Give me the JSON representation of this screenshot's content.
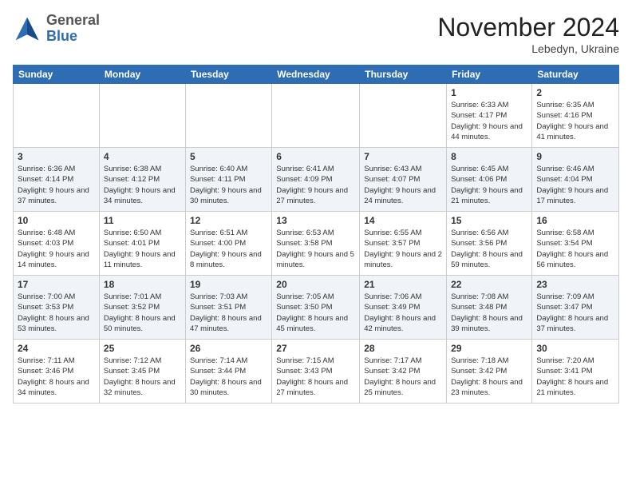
{
  "logo": {
    "general": "General",
    "blue": "Blue"
  },
  "header": {
    "month": "November 2024",
    "location": "Lebedyn, Ukraine"
  },
  "days_of_week": [
    "Sunday",
    "Monday",
    "Tuesday",
    "Wednesday",
    "Thursday",
    "Friday",
    "Saturday"
  ],
  "weeks": [
    [
      {
        "day": "",
        "info": ""
      },
      {
        "day": "",
        "info": ""
      },
      {
        "day": "",
        "info": ""
      },
      {
        "day": "",
        "info": ""
      },
      {
        "day": "",
        "info": ""
      },
      {
        "day": "1",
        "info": "Sunrise: 6:33 AM\nSunset: 4:17 PM\nDaylight: 9 hours\nand 44 minutes."
      },
      {
        "day": "2",
        "info": "Sunrise: 6:35 AM\nSunset: 4:16 PM\nDaylight: 9 hours\nand 41 minutes."
      }
    ],
    [
      {
        "day": "3",
        "info": "Sunrise: 6:36 AM\nSunset: 4:14 PM\nDaylight: 9 hours\nand 37 minutes."
      },
      {
        "day": "4",
        "info": "Sunrise: 6:38 AM\nSunset: 4:12 PM\nDaylight: 9 hours\nand 34 minutes."
      },
      {
        "day": "5",
        "info": "Sunrise: 6:40 AM\nSunset: 4:11 PM\nDaylight: 9 hours\nand 30 minutes."
      },
      {
        "day": "6",
        "info": "Sunrise: 6:41 AM\nSunset: 4:09 PM\nDaylight: 9 hours\nand 27 minutes."
      },
      {
        "day": "7",
        "info": "Sunrise: 6:43 AM\nSunset: 4:07 PM\nDaylight: 9 hours\nand 24 minutes."
      },
      {
        "day": "8",
        "info": "Sunrise: 6:45 AM\nSunset: 4:06 PM\nDaylight: 9 hours\nand 21 minutes."
      },
      {
        "day": "9",
        "info": "Sunrise: 6:46 AM\nSunset: 4:04 PM\nDaylight: 9 hours\nand 17 minutes."
      }
    ],
    [
      {
        "day": "10",
        "info": "Sunrise: 6:48 AM\nSunset: 4:03 PM\nDaylight: 9 hours\nand 14 minutes."
      },
      {
        "day": "11",
        "info": "Sunrise: 6:50 AM\nSunset: 4:01 PM\nDaylight: 9 hours\nand 11 minutes."
      },
      {
        "day": "12",
        "info": "Sunrise: 6:51 AM\nSunset: 4:00 PM\nDaylight: 9 hours\nand 8 minutes."
      },
      {
        "day": "13",
        "info": "Sunrise: 6:53 AM\nSunset: 3:58 PM\nDaylight: 9 hours\nand 5 minutes."
      },
      {
        "day": "14",
        "info": "Sunrise: 6:55 AM\nSunset: 3:57 PM\nDaylight: 9 hours\nand 2 minutes."
      },
      {
        "day": "15",
        "info": "Sunrise: 6:56 AM\nSunset: 3:56 PM\nDaylight: 8 hours\nand 59 minutes."
      },
      {
        "day": "16",
        "info": "Sunrise: 6:58 AM\nSunset: 3:54 PM\nDaylight: 8 hours\nand 56 minutes."
      }
    ],
    [
      {
        "day": "17",
        "info": "Sunrise: 7:00 AM\nSunset: 3:53 PM\nDaylight: 8 hours\nand 53 minutes."
      },
      {
        "day": "18",
        "info": "Sunrise: 7:01 AM\nSunset: 3:52 PM\nDaylight: 8 hours\nand 50 minutes."
      },
      {
        "day": "19",
        "info": "Sunrise: 7:03 AM\nSunset: 3:51 PM\nDaylight: 8 hours\nand 47 minutes."
      },
      {
        "day": "20",
        "info": "Sunrise: 7:05 AM\nSunset: 3:50 PM\nDaylight: 8 hours\nand 45 minutes."
      },
      {
        "day": "21",
        "info": "Sunrise: 7:06 AM\nSunset: 3:49 PM\nDaylight: 8 hours\nand 42 minutes."
      },
      {
        "day": "22",
        "info": "Sunrise: 7:08 AM\nSunset: 3:48 PM\nDaylight: 8 hours\nand 39 minutes."
      },
      {
        "day": "23",
        "info": "Sunrise: 7:09 AM\nSunset: 3:47 PM\nDaylight: 8 hours\nand 37 minutes."
      }
    ],
    [
      {
        "day": "24",
        "info": "Sunrise: 7:11 AM\nSunset: 3:46 PM\nDaylight: 8 hours\nand 34 minutes."
      },
      {
        "day": "25",
        "info": "Sunrise: 7:12 AM\nSunset: 3:45 PM\nDaylight: 8 hours\nand 32 minutes."
      },
      {
        "day": "26",
        "info": "Sunrise: 7:14 AM\nSunset: 3:44 PM\nDaylight: 8 hours\nand 30 minutes."
      },
      {
        "day": "27",
        "info": "Sunrise: 7:15 AM\nSunset: 3:43 PM\nDaylight: 8 hours\nand 27 minutes."
      },
      {
        "day": "28",
        "info": "Sunrise: 7:17 AM\nSunset: 3:42 PM\nDaylight: 8 hours\nand 25 minutes."
      },
      {
        "day": "29",
        "info": "Sunrise: 7:18 AM\nSunset: 3:42 PM\nDaylight: 8 hours\nand 23 minutes."
      },
      {
        "day": "30",
        "info": "Sunrise: 7:20 AM\nSunset: 3:41 PM\nDaylight: 8 hours\nand 21 minutes."
      }
    ]
  ]
}
